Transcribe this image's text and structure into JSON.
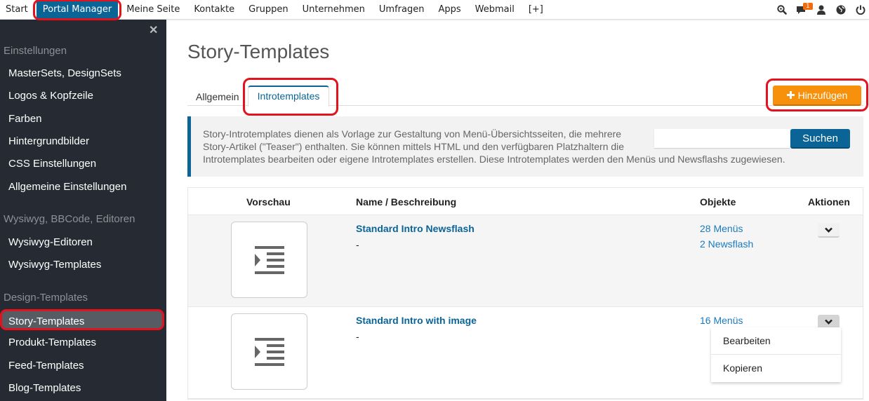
{
  "topnav": {
    "items": [
      "Start",
      "Portal Manager",
      "Meine Seite",
      "Kontakte",
      "Gruppen",
      "Unternehmen",
      "Umfragen",
      "Apps",
      "Webmail",
      "[+]"
    ],
    "active": "Portal Manager",
    "icons": [
      "search-icon",
      "messages-icon",
      "user-icon",
      "globe-icon",
      "power-icon"
    ],
    "messages_badge": "1"
  },
  "sidebar": {
    "close": "✕",
    "sections": [
      {
        "title": "Einstellungen",
        "items": [
          "MasterSets, DesignSets",
          "Logos & Kopfzeile",
          "Farben",
          "Hintergrundbilder",
          "CSS Einstellungen",
          "Allgemeine Einstellungen"
        ]
      },
      {
        "title": "Wysiwyg, BBCode, Editoren",
        "items": [
          "Wysiwyg-Editoren",
          "Wysiwyg-Templates"
        ]
      },
      {
        "title": "Design-Templates",
        "items": [
          "Story-Templates",
          "Produkt-Templates",
          "Feed-Templates",
          "Blog-Templates"
        ]
      }
    ],
    "active": "Story-Templates"
  },
  "page": {
    "title": "Story-Templates",
    "tabs": [
      "Allgemein",
      "Introtemplates"
    ],
    "active_tab": "Introtemplates",
    "add_button": "Hinzufügen"
  },
  "info": {
    "line1": "Story-Introtemplates dienen als Vorlage zur Gestaltung von Menü-Übersichtsseiten, die mehrere",
    "line2": "Story-Artikel (\"Teaser\") enthalten. Sie können mittels HTML und den verfügbaren Platzhaltern die",
    "line3": "Introtemplates bearbeiten oder eigene Introtemplates erstellen. Diese Introtemplates werden den Menüs und Newsflashs zugewiesen.",
    "search_value": "",
    "search_button": "Suchen"
  },
  "table": {
    "headers": [
      "Vorschau",
      "Name / Beschreibung",
      "Objekte",
      "Aktionen"
    ],
    "rows": [
      {
        "name": "Standard Intro Newsflash",
        "description": "-",
        "objects": [
          "28 Menüs",
          "2 Newsflash"
        ]
      },
      {
        "name": "Standard Intro with image",
        "description": "-",
        "objects": [
          "16 Menüs"
        ]
      }
    ],
    "dropdown": [
      "Bearbeiten",
      "Kopieren"
    ]
  }
}
